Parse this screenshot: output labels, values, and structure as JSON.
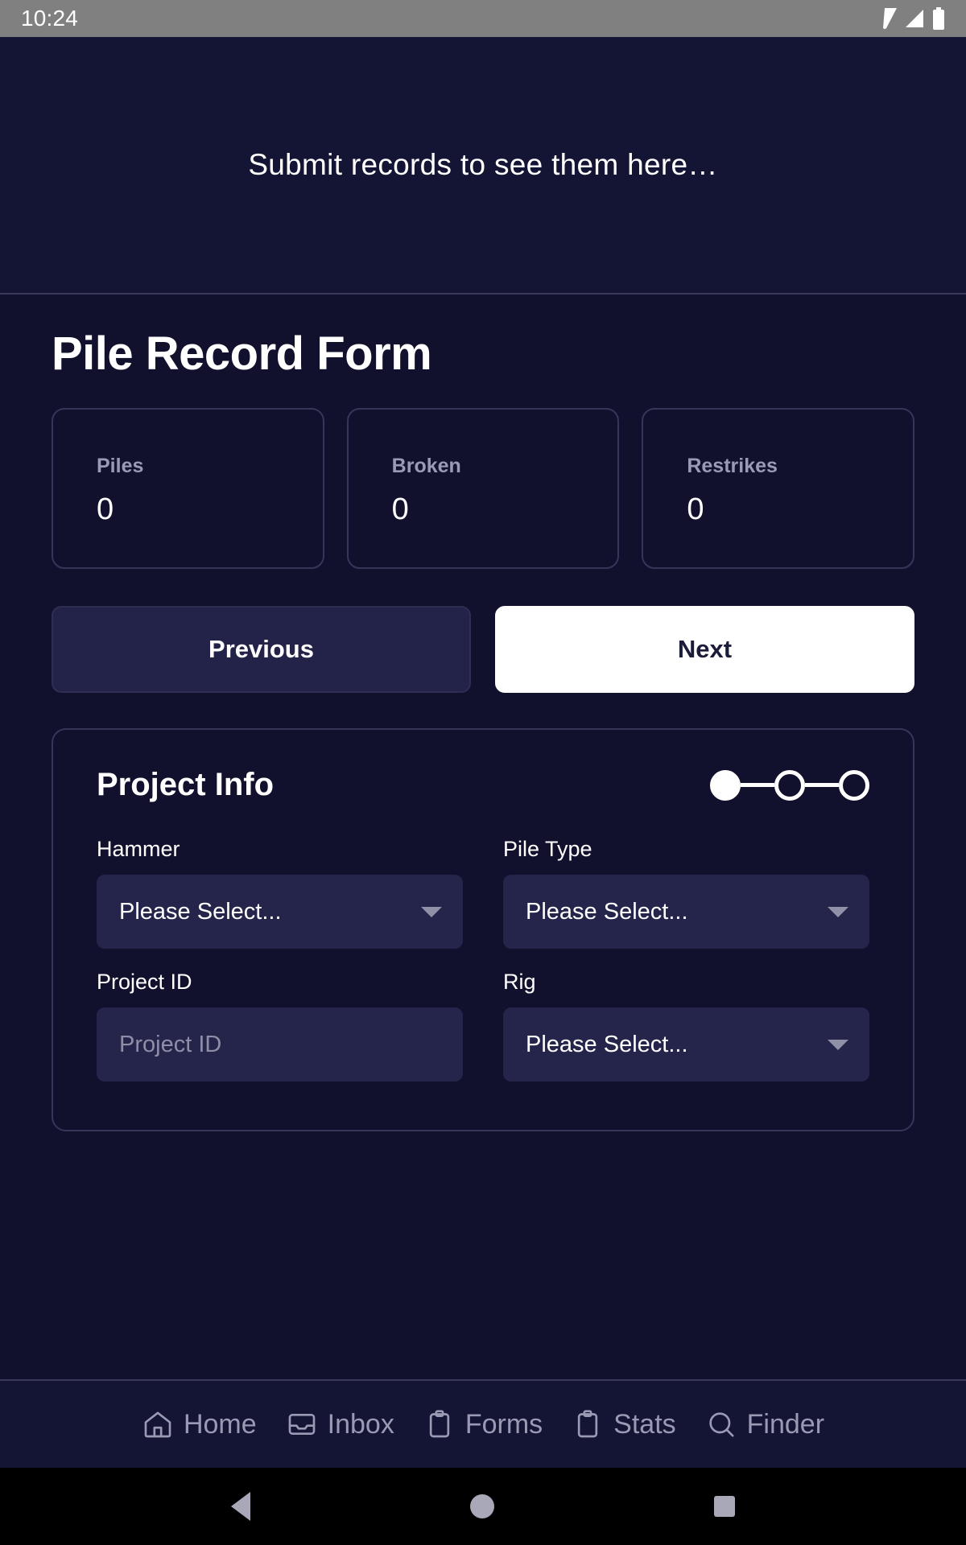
{
  "status_bar": {
    "time": "10:24",
    "icons": [
      "wifi-icon",
      "cellular-signal-icon",
      "battery-icon"
    ]
  },
  "records_pane": {
    "empty_message": "Submit records to see them here…"
  },
  "form": {
    "title": "Pile Record Form",
    "stats": [
      {
        "label": "Piles",
        "value": "0"
      },
      {
        "label": "Broken",
        "value": "0"
      },
      {
        "label": "Restrikes",
        "value": "0"
      }
    ],
    "buttons": {
      "previous": "Previous",
      "next": "Next"
    },
    "section": {
      "title": "Project Info",
      "stepper": {
        "total": 3,
        "active_index": 0
      },
      "fields": [
        {
          "label": "Hammer",
          "type": "select",
          "value": "Please Select...",
          "is_placeholder": false
        },
        {
          "label": "Pile Type",
          "type": "select",
          "value": "Please Select...",
          "is_placeholder": false
        },
        {
          "label": "Project ID",
          "type": "text",
          "value": "",
          "placeholder": "Project ID",
          "is_placeholder": true
        },
        {
          "label": "Rig",
          "type": "select",
          "value": "Please Select...",
          "is_placeholder": false
        }
      ]
    }
  },
  "app_nav": {
    "items": [
      {
        "label": "Home",
        "icon": "home-icon"
      },
      {
        "label": "Inbox",
        "icon": "inbox-icon"
      },
      {
        "label": "Forms",
        "icon": "clipboard-icon"
      },
      {
        "label": "Stats",
        "icon": "clipboard-icon"
      },
      {
        "label": "Finder",
        "icon": "search-icon"
      }
    ]
  },
  "system_nav": {
    "back": "back-triangle-icon",
    "home": "home-circle-icon",
    "recents": "recents-square-icon"
  },
  "colors": {
    "background": "#11112e",
    "panel": "#141434",
    "card_border": "#36365a",
    "control_fill": "#25254c",
    "accent_white": "#ffffff",
    "muted_text": "#9a9ab4",
    "status_bar": "#808080"
  }
}
